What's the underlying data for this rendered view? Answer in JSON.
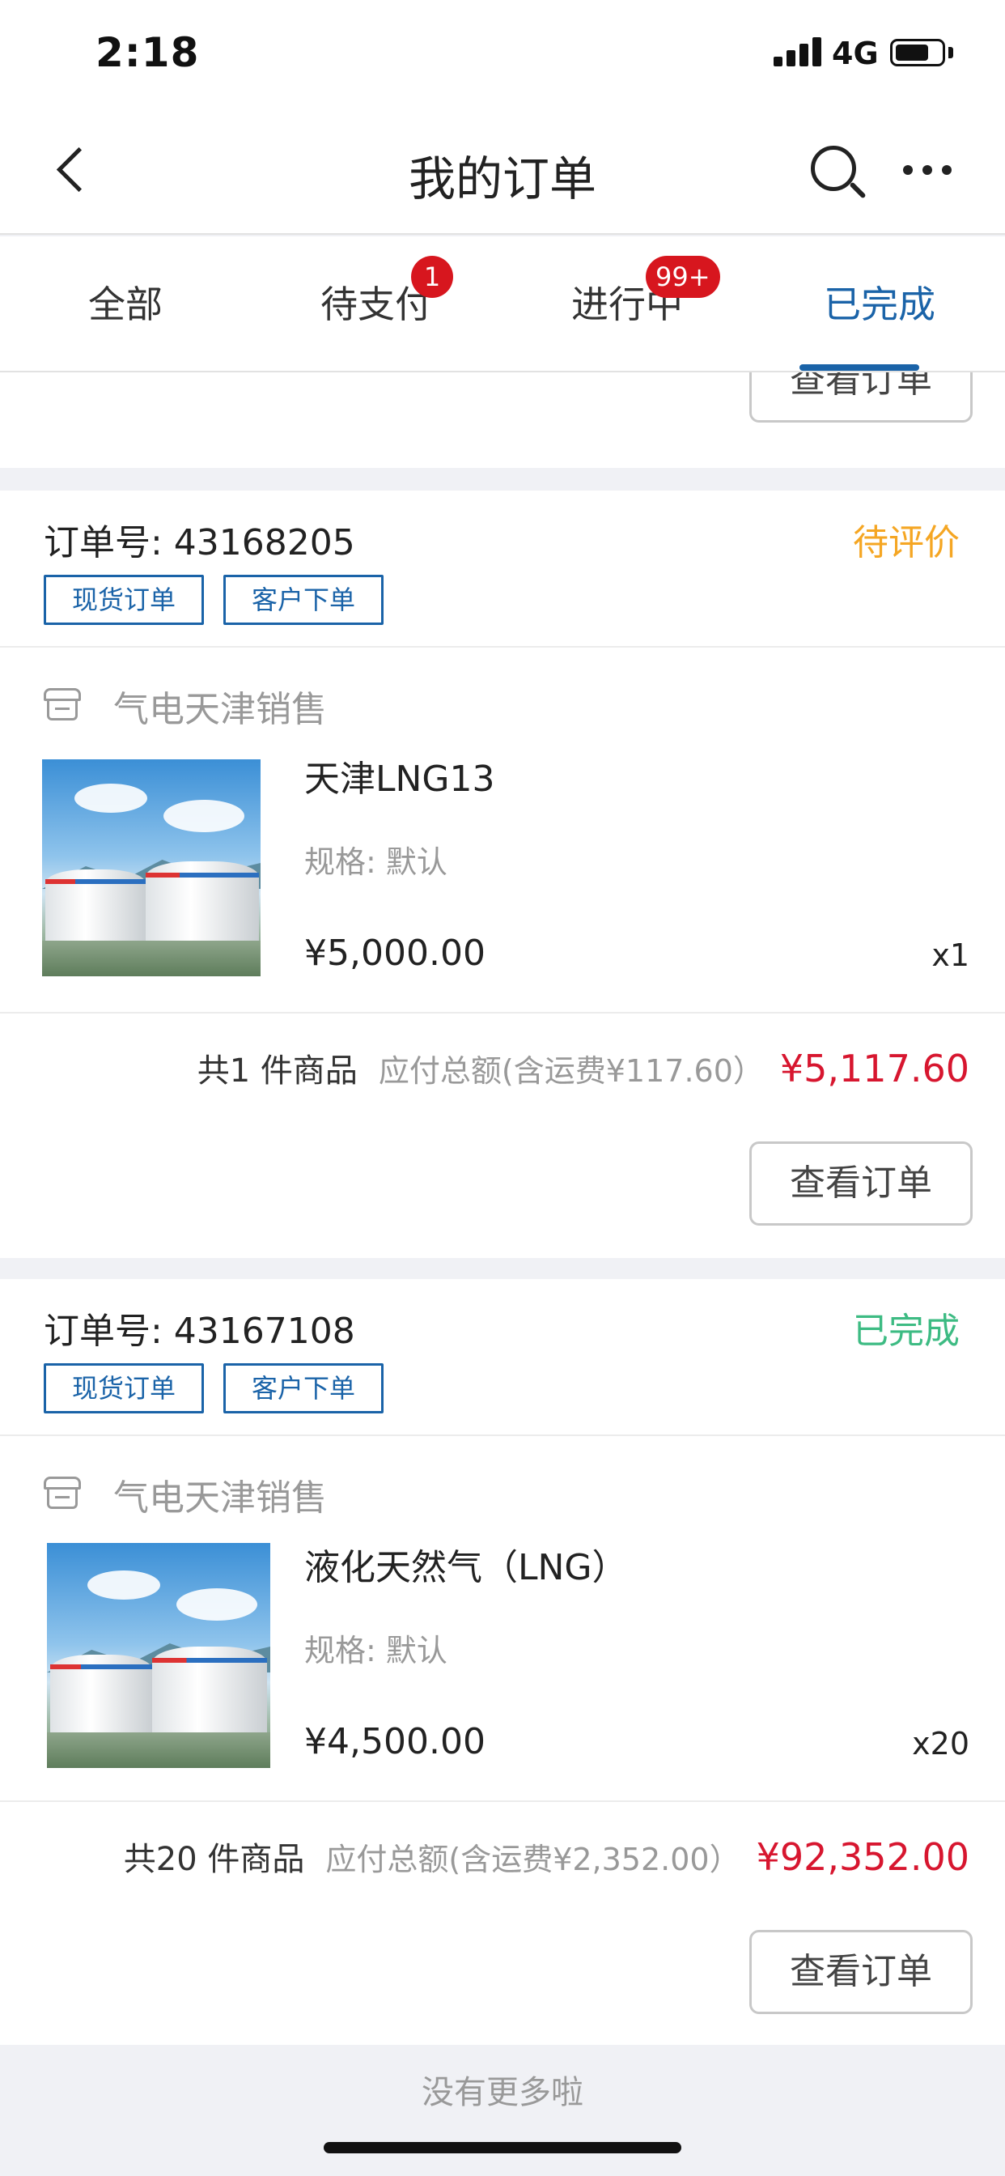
{
  "status_bar": {
    "time": "2:18",
    "network": "4G"
  },
  "nav": {
    "title": "我的订单"
  },
  "tabs": [
    {
      "label": "全部"
    },
    {
      "label": "待支付",
      "badge": "1"
    },
    {
      "label": "进行中",
      "badge": "99+"
    },
    {
      "label": "已完成",
      "active": true
    }
  ],
  "view_order_label": "查看订单",
  "orders": [
    {
      "order_no": "订单号: 43168205",
      "status": "待评价",
      "status_color": "#f5a623",
      "tags": [
        "现货订单",
        "客户下单"
      ],
      "store": "气电天津销售",
      "product_name": "天津LNG13",
      "spec": "规格: 默认",
      "price": "¥5,000.00",
      "qty": "x1",
      "count": "共1 件商品",
      "payable": "应付总额(含运费¥117.60）",
      "total": "¥5,117.60"
    },
    {
      "order_no": "订单号: 43167108",
      "status": "已完成",
      "status_color": "#3dbb83",
      "tags": [
        "现货订单",
        "客户下单"
      ],
      "store": "气电天津销售",
      "product_name": "液化天然气（LNG）",
      "spec": "规格: 默认",
      "price": "¥4,500.00",
      "qty": "x20",
      "count": "共20 件商品",
      "payable": "应付总额(含运费¥2,352.00）",
      "total": "¥92,352.00"
    }
  ],
  "footer_note": "没有更多啦",
  "colors": {
    "accent": "#1a63a8",
    "price_red": "#d7162f",
    "badge_red": "#d7161e"
  }
}
